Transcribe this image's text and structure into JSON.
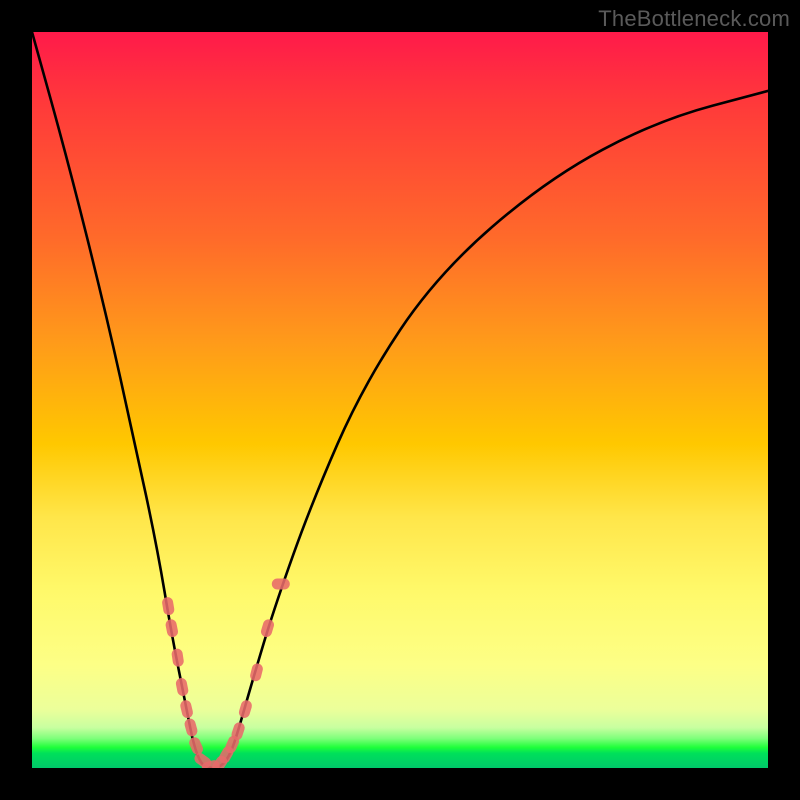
{
  "watermark": {
    "text": "TheBottleneck.com"
  },
  "chart_data": {
    "type": "line",
    "title": "",
    "xlabel": "",
    "ylabel": "",
    "xlim": [
      0,
      100
    ],
    "ylim": [
      0,
      100
    ],
    "series": [
      {
        "name": "bottleneck-curve",
        "x": [
          0,
          5,
          10,
          14,
          17,
          19,
          21,
          22,
          23,
          24,
          25,
          26,
          27,
          28,
          30,
          33,
          38,
          45,
          55,
          70,
          85,
          100
        ],
        "values": [
          100,
          82,
          62,
          44,
          30,
          18,
          8,
          3,
          0.5,
          0,
          0,
          0.5,
          2,
          5,
          12,
          22,
          36,
          52,
          67,
          80,
          88,
          92
        ]
      }
    ],
    "markers": {
      "name": "sample-points",
      "points": [
        {
          "x": 18.5,
          "y": 22
        },
        {
          "x": 19.0,
          "y": 19
        },
        {
          "x": 19.8,
          "y": 15
        },
        {
          "x": 20.4,
          "y": 11
        },
        {
          "x": 21.0,
          "y": 8
        },
        {
          "x": 21.6,
          "y": 5.5
        },
        {
          "x": 22.3,
          "y": 3
        },
        {
          "x": 23.2,
          "y": 1
        },
        {
          "x": 24.3,
          "y": 0.2
        },
        {
          "x": 25.5,
          "y": 0.5
        },
        {
          "x": 26.4,
          "y": 1.8
        },
        {
          "x": 27.2,
          "y": 3.2
        },
        {
          "x": 28.0,
          "y": 5
        },
        {
          "x": 29.0,
          "y": 8
        },
        {
          "x": 30.5,
          "y": 13
        },
        {
          "x": 32.0,
          "y": 19
        },
        {
          "x": 33.8,
          "y": 25
        }
      ]
    },
    "annotations": []
  }
}
